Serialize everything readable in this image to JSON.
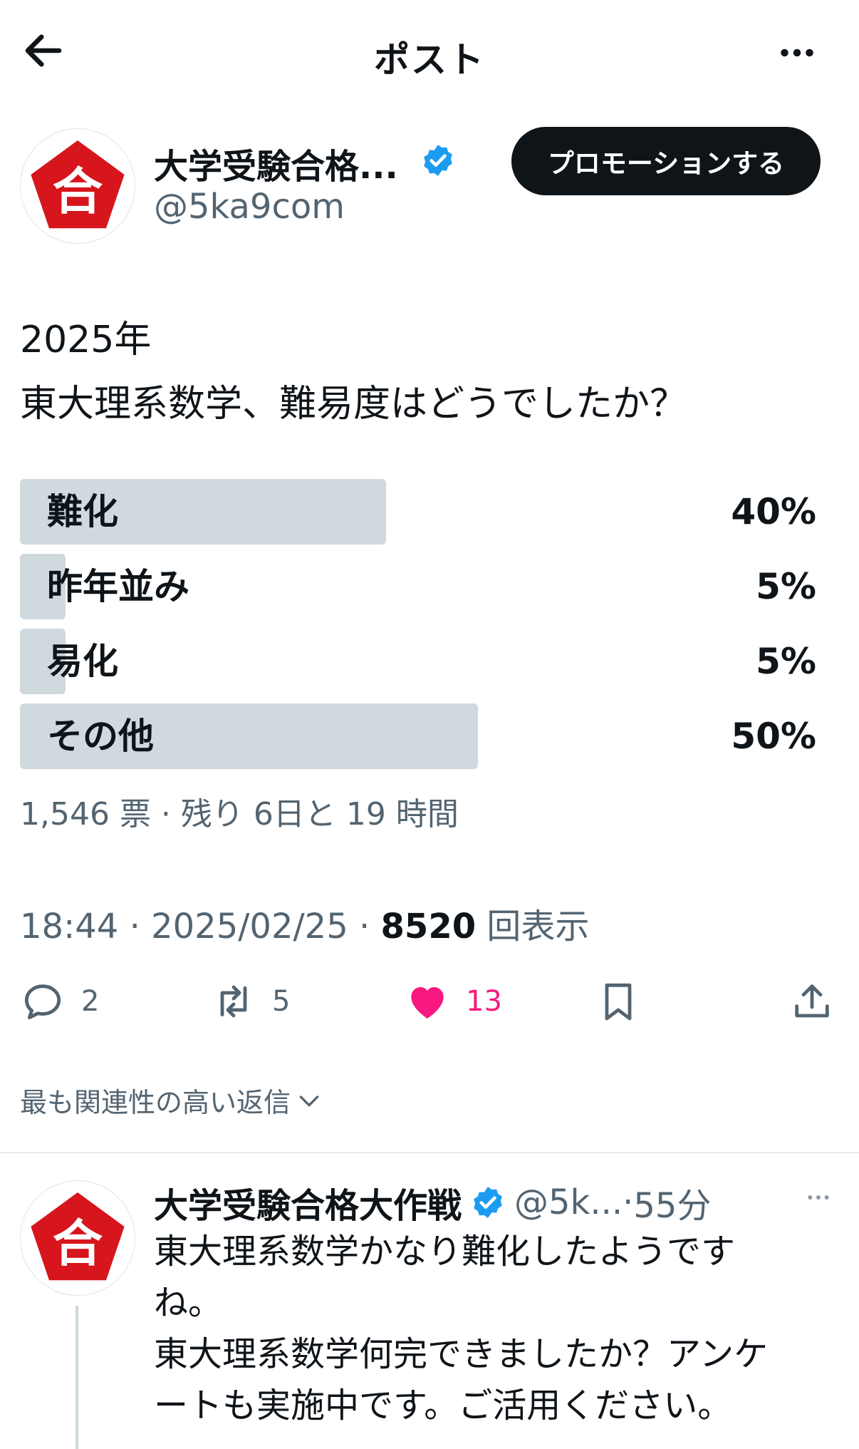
{
  "header": {
    "title": "ポスト",
    "back_icon": "arrow-left-icon",
    "more_icon": "more-horizontal-icon"
  },
  "author": {
    "name": "大学受験合格...",
    "handle": "@5ka9com",
    "promote_label": "プロモーションする",
    "avatar_glyph": "合"
  },
  "post": {
    "text": "2025年\n東大理系数学、難易度はどうでしたか？"
  },
  "poll": {
    "options": [
      {
        "label": "難化",
        "percent": "40%",
        "value": 40
      },
      {
        "label": "昨年並み",
        "percent": "5%",
        "value": 5
      },
      {
        "label": "易化",
        "percent": "5%",
        "value": 5
      },
      {
        "label": "その他",
        "percent": "50%",
        "value": 50
      }
    ],
    "meta": "1,546 票 · 残り 6日と 19 時間"
  },
  "timestamp": {
    "time_date": "18:44 · 2025/02/25 · ",
    "views": "8520",
    "views_suffix": " 回表示"
  },
  "actions": {
    "reply_count": "2",
    "repost_count": "5",
    "like_count": "13"
  },
  "replies": {
    "sort_label": "最も関連性の高い返信"
  },
  "reply": {
    "name": "大学受験合格大作戦",
    "handle": "@5k...",
    "dot": " · ",
    "time": "55分",
    "text": "東大理系数学かなり難化したようです\nね。\n東大理系数学何完できましたか？アンケ\nートも実施中です。ご活用ください。"
  },
  "colors": {
    "accent_like": "#f91880",
    "verified": "#1d9bf0",
    "brand_red": "#d7151c",
    "poll_bar": "#cfd9de"
  }
}
